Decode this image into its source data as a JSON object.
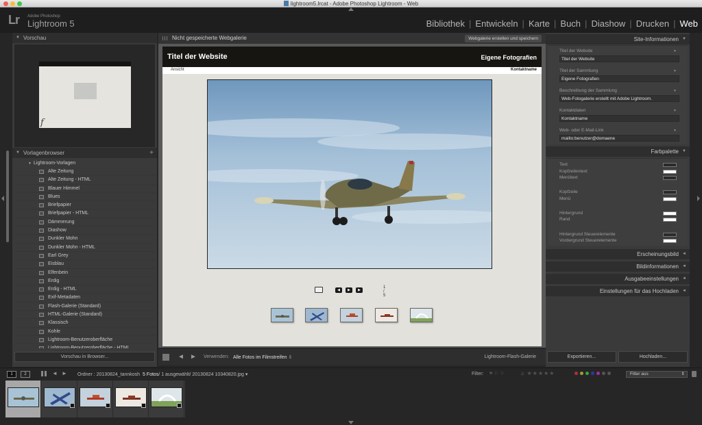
{
  "window": {
    "title": "lightroom5.lrcat - Adobe Photoshop Lightroom - Web"
  },
  "brand": {
    "logo": "Lr",
    "vendor": "Adobe Photoshop",
    "product": "Lightroom 5"
  },
  "modules": [
    {
      "label": "Bibliothek",
      "active": false
    },
    {
      "label": "Entwickeln",
      "active": false
    },
    {
      "label": "Karte",
      "active": false
    },
    {
      "label": "Buch",
      "active": false
    },
    {
      "label": "Diashow",
      "active": false
    },
    {
      "label": "Drucken",
      "active": false
    },
    {
      "label": "Web",
      "active": true
    }
  ],
  "left_panel": {
    "preview_header": "Vorschau",
    "templates_header": "Vorlagenbrowser",
    "templates_add": "+",
    "template_folder": "Lightroom-Vorlagen",
    "templates": [
      "Alte Zeitung",
      "Alte Zeitung - HTML",
      "Blauer Himmel",
      "Blues",
      "Briefpapier",
      "Briefpapier - HTML",
      "Dämmerung",
      "Diashow",
      "Dunkler Mohn",
      "Dunkler Mohn - HTML",
      "Earl Grey",
      "Eisblau",
      "Elfenbein",
      "Erdig",
      "Erdig - HTML",
      "Exif-Metadaten",
      "Flash-Galerie (Standard)",
      "HTML-Galerie (Standard)",
      "Klassisch",
      "Kohle",
      "Lightroom-Benutzeroberfläche",
      "Lightroom-Benutzeroberfläche - HTML"
    ],
    "preview_button": "Vorschau in Browser..."
  },
  "center": {
    "status": "Nicht gespeicherte Webgalerie",
    "create_button": "Webgalerie erstellen und speichern",
    "site": {
      "title": "Titel der Website",
      "collection": "Eigene Fotografien",
      "view_link": "Ansicht",
      "contact": "Kontaktname",
      "counter": "1 / 5"
    },
    "footer": {
      "use_label": "Verwenden:",
      "use_value": "Alle Fotos im Filmstreifen",
      "engine": "Lightroom-Flash-Galerie"
    }
  },
  "right_panel": {
    "site_info_header": "Site-Informationen",
    "fields": [
      {
        "label": "Titel der Website",
        "value": "Titel der Website"
      },
      {
        "label": "Titel der Sammlung",
        "value": "Eigene Fotografien"
      },
      {
        "label": "Beschreibung der Sammlung",
        "value": "Web-Fotogalerie erstellt mit Adobe Lightroom."
      },
      {
        "label": "Kontaktdaten",
        "value": "Kontaktname"
      },
      {
        "label": "Web- oder E-Mail-Link",
        "value": "mailto:benutzer@domaene"
      }
    ],
    "palette_header": "Farbpalette",
    "palette": [
      {
        "label": "Text",
        "color": "#2a2a2a"
      },
      {
        "label": "Kopfzeilentext",
        "color": "#ffffff"
      },
      {
        "label": "Menütext",
        "color": "#2a2a2a"
      },
      {
        "label": "Kopfzeile",
        "color": "#2a2a2a"
      },
      {
        "label": "Menü",
        "color": "#ffffff"
      },
      {
        "label": "Hintergrund",
        "color": "#ffffff"
      },
      {
        "label": "Rand",
        "color": "#ffffff"
      },
      {
        "label": "Hintergrund Steuerelemente",
        "color": "#2a2a2a"
      },
      {
        "label": "Vordergrund Steuerelemente",
        "color": "#ffffff"
      }
    ],
    "collapsed_sections": [
      "Erscheinungsbild",
      "Bildinformationen",
      "Ausgabeeinstellungen",
      "Einstellungen für das Hochladen"
    ],
    "export_button": "Exportieren...",
    "upload_button": "Hochladen..."
  },
  "filmstrip_bar": {
    "page1": "1",
    "page2": "2",
    "folder": "Ordner : 20130824_tannkosh",
    "count": "5 Fotos",
    "selection": "/ 1 ausgewählt/ 20130824 10340820.jpg",
    "filter_label": "Filter:",
    "filter_value": "Filter aus"
  },
  "icons": {
    "apple": "traffic-lights",
    "grid": "grid-icon",
    "back": "◄",
    "forward": "►"
  }
}
